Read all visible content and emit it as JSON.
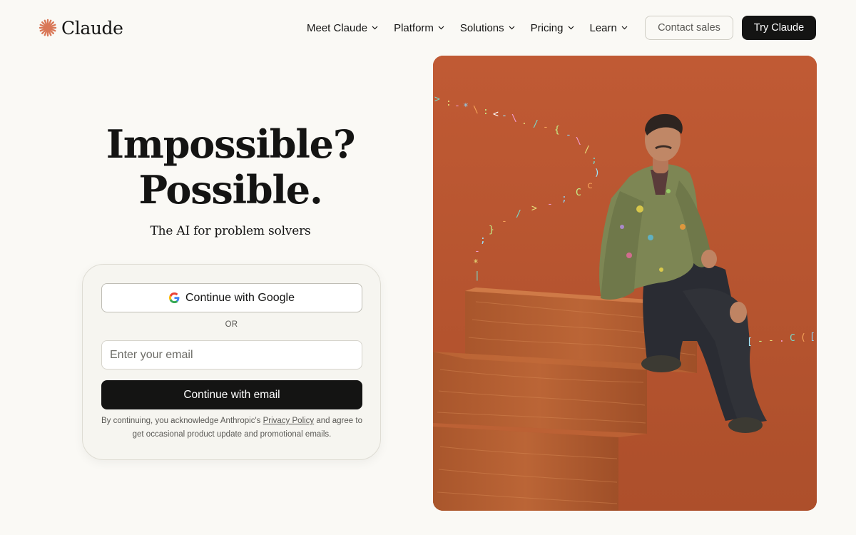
{
  "header": {
    "logo_text": "Claude",
    "nav": [
      {
        "label": "Meet Claude"
      },
      {
        "label": "Platform"
      },
      {
        "label": "Solutions"
      },
      {
        "label": "Pricing"
      },
      {
        "label": "Learn"
      }
    ],
    "contact_label": "Contact sales",
    "try_label": "Try Claude"
  },
  "hero": {
    "title_line1": "Impossible?",
    "title_line2": "Possible.",
    "subtitle": "The AI for problem solvers"
  },
  "signin": {
    "google_label": "Continue with Google",
    "or_label": "OR",
    "email_placeholder": "Enter your email",
    "email_value": "",
    "email_button_label": "Continue with email",
    "legal_prefix": "By continuing, you acknowledge Anthropic's ",
    "legal_link": "Privacy Policy",
    "legal_suffix": " and agree to get occasional product update and promotional emails."
  },
  "icons": {
    "logo": "claude-starburst-icon",
    "chevron": "chevron-down-icon",
    "google": "google-g-icon"
  },
  "colors": {
    "background": "#faf9f5",
    "brand_accent": "#d97757",
    "primary_button": "#141413",
    "image_background": "#b8562f"
  }
}
